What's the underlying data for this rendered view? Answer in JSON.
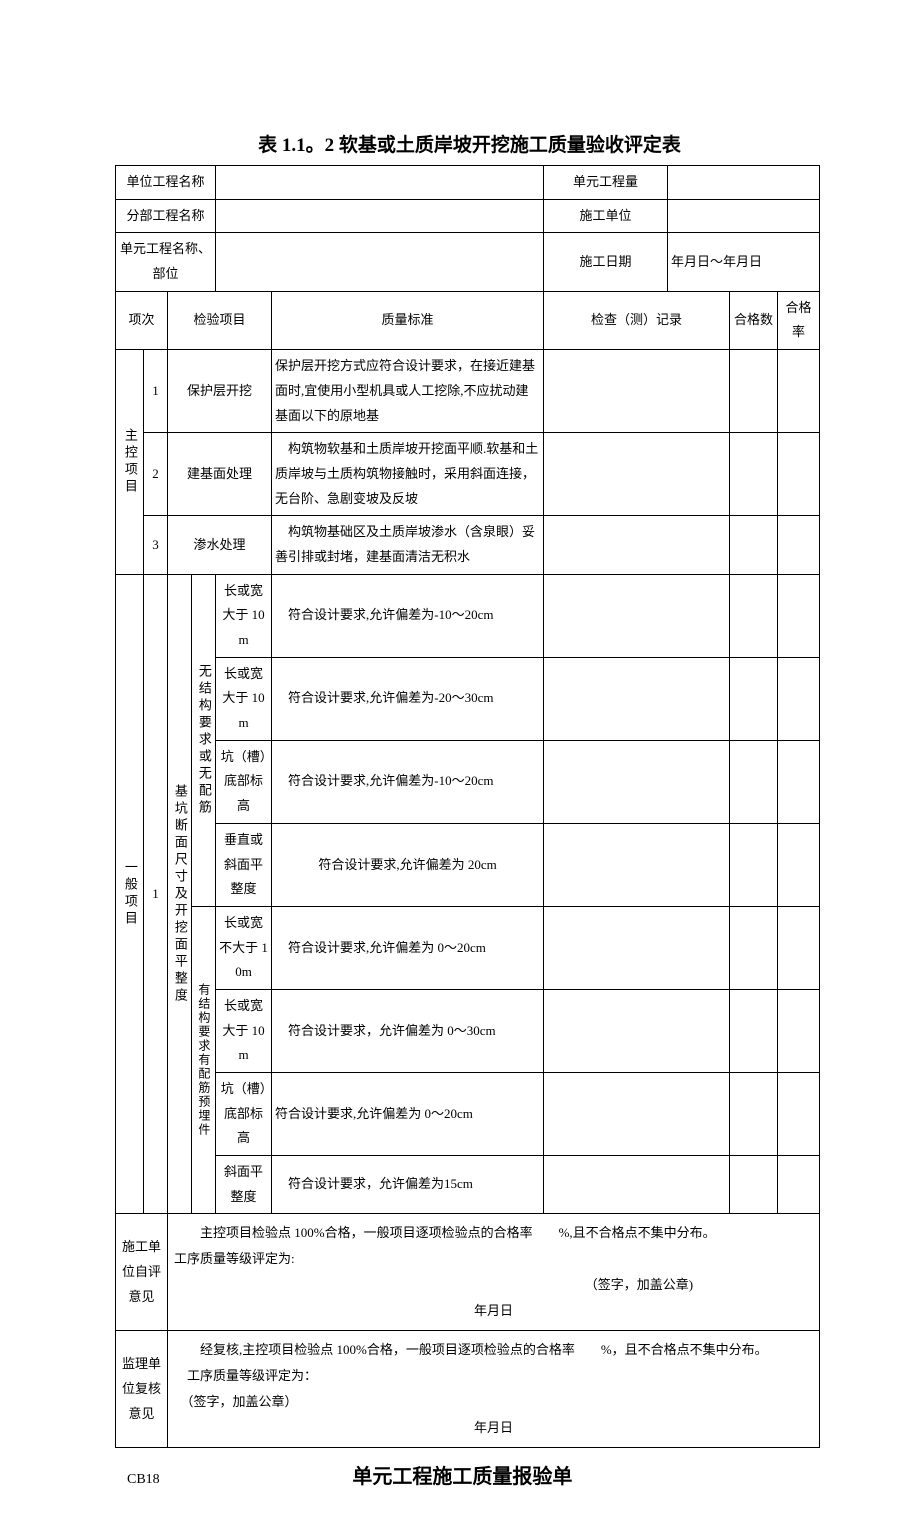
{
  "title": "表 1.1。2 软基或土质岸坡开挖施工质量验收评定表",
  "header": {
    "unitProjectNameLabel": "单位工程名称",
    "unitProjectName": "",
    "unitProjectQtyLabel": "单元工程量",
    "unitProjectQty": "",
    "subProjectNameLabel": "分部工程名称",
    "subProjectName": "",
    "constructionUnitLabel": "施工单位",
    "constructionUnit": "",
    "unitPartLabel": "单元工程名称、部位",
    "unitPart": "",
    "constructionDateLabel": "施工日期",
    "constructionDate": "年月日～年月日"
  },
  "columns": {
    "itemNo": "项次",
    "inspectItem": "检验项目",
    "qualityStd": "质量标准",
    "checkRecord": "检查（测）记录",
    "passCount": "合格数",
    "passRate": "合格率"
  },
  "groups": {
    "main": "主控项目",
    "general": "一般项目"
  },
  "mainItems": [
    {
      "no": "1",
      "name": "保护层开挖",
      "std": "保护层开挖方式应符合设计要求，在接近建基面时,宜使用小型机具或人工挖除,不应扰动建基面以下的原地基"
    },
    {
      "no": "2",
      "name": "建基面处理",
      "std": "　构筑物软基和土质岸坡开挖面平顺.软基和土质岸坡与土质构筑物接触时，采用斜面连接，无台阶、急剧变坡及反坡"
    },
    {
      "no": "3",
      "name": "渗水处理",
      "std": "　构筑物基础区及土质岸坡渗水（含泉眼）妥善引排或封堵，建基面清洁无积水"
    }
  ],
  "generalGroup": {
    "no": "1",
    "outerName": "基坑断面尺寸及开挖面平整度",
    "subGroups": {
      "noRebar": "无结构要求或无配筋",
      "hasRebar": "有结构要求有配筋预埋件"
    },
    "rows": {
      "nr1": {
        "label": "长或宽大于 10m",
        "std": "　符合设计要求,允许偏差为-10～20cm"
      },
      "nr2": {
        "label": "长或宽大于 10m",
        "std": "　符合设计要求,允许偏差为-20～30cm"
      },
      "nr3": {
        "label": "坑（槽）底部标高",
        "std": "　符合设计要求,允许偏差为-10～20cm"
      },
      "nr4": {
        "label": "垂直或斜面平整度",
        "std": "符合设计要求,允许偏差为 20cm"
      },
      "hr1": {
        "label": "长或宽不大于 10m",
        "std": "　符合设计要求,允许偏差为 0～20cm"
      },
      "hr2": {
        "label": "长或宽大于 10m",
        "std": "　符合设计要求，允许偏差为 0～30cm"
      },
      "hr3": {
        "label": "坑（槽）底部标高",
        "std": "符合设计要求,允许偏差为 0～20cm"
      },
      "hr4": {
        "label": "斜面平整度",
        "std": "　符合设计要求，允许偏差为15cm"
      }
    }
  },
  "opinions": {
    "selfLabel": "施工单位自评意见",
    "selfText1": "　　主控项目检验点 100%合格，一般项目逐项检验点的合格率　　%,且不合格点不集中分布。",
    "selfText2": "工序质量等级评定为:",
    "selfSign": "（签字，加盖公章)",
    "selfDate": "年月日",
    "reviewLabel": "监理单位复核意见",
    "reviewText1": "　　经复核,主控项目检验点 100%合格，一般项目逐项检验点的合格率　　%，且不合格点不集中分布。",
    "reviewText2": "　工序质量等级评定为：",
    "reviewSign": "　（签字，加盖公章）",
    "reviewDate": "年月日"
  },
  "footer": {
    "code": "CB18",
    "title": "单元工程施工质量报验单"
  }
}
